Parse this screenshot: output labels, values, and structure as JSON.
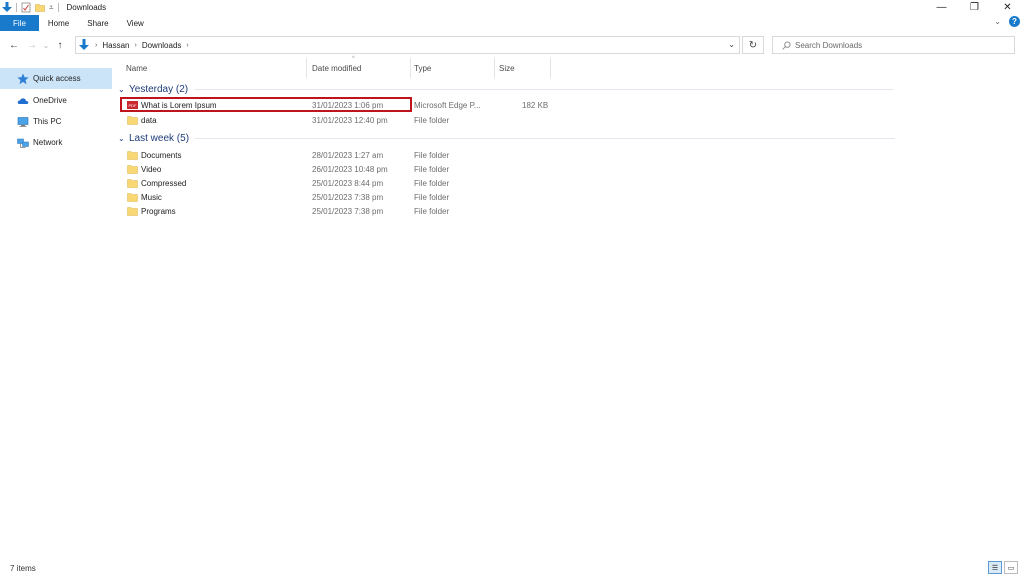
{
  "window": {
    "title": "Downloads",
    "minimize": "—",
    "restore": "❐",
    "close": "✕"
  },
  "ribbon": {
    "tabs": [
      "File",
      "Home",
      "Share",
      "View"
    ],
    "expand": "⌄",
    "help": "?"
  },
  "nav": {
    "back": "←",
    "forward": "→",
    "recent": "⌄",
    "up": "↑"
  },
  "address": {
    "crumbs": [
      "Hassan",
      "Downloads"
    ],
    "separator": "›",
    "dropdown": "⌄",
    "refresh": "↻"
  },
  "search": {
    "placeholder": "Search Downloads"
  },
  "sidebar": {
    "items": [
      "Quick access",
      "OneDrive",
      "This PC",
      "Network"
    ]
  },
  "columns": {
    "name": "Name",
    "date": "Date modified",
    "type": "Type",
    "size": "Size"
  },
  "groups": [
    {
      "title": "Yesterday (2)",
      "rows": [
        {
          "name": "What is Lorem Ipsum",
          "date": "31/01/2023 1:06 pm",
          "type": "Microsoft Edge P...",
          "size": "182 KB",
          "icon": "pdf-icon"
        },
        {
          "name": "data",
          "date": "31/01/2023 12:40 pm",
          "type": "File folder",
          "size": "",
          "icon": "folder-icon"
        }
      ]
    },
    {
      "title": "Last week (5)",
      "rows": [
        {
          "name": "Documents",
          "date": "28/01/2023 1:27 am",
          "type": "File folder",
          "size": "",
          "icon": "folder-icon"
        },
        {
          "name": "Video",
          "date": "26/01/2023 10:48 pm",
          "type": "File folder",
          "size": "",
          "icon": "folder-icon"
        },
        {
          "name": "Compressed",
          "date": "25/01/2023 8:44 pm",
          "type": "File folder",
          "size": "",
          "icon": "folder-icon"
        },
        {
          "name": "Music",
          "date": "25/01/2023 7:38 pm",
          "type": "File folder",
          "size": "",
          "icon": "folder-icon"
        },
        {
          "name": "Programs",
          "date": "25/01/2023 7:38 pm",
          "type": "File folder",
          "size": "",
          "icon": "folder-icon"
        }
      ]
    }
  ],
  "status": {
    "count": "7 items"
  },
  "colors": {
    "accent": "#1979ca",
    "highlight": "#c0141c",
    "selected": "#cce4f7",
    "folder": "#f8d775"
  }
}
